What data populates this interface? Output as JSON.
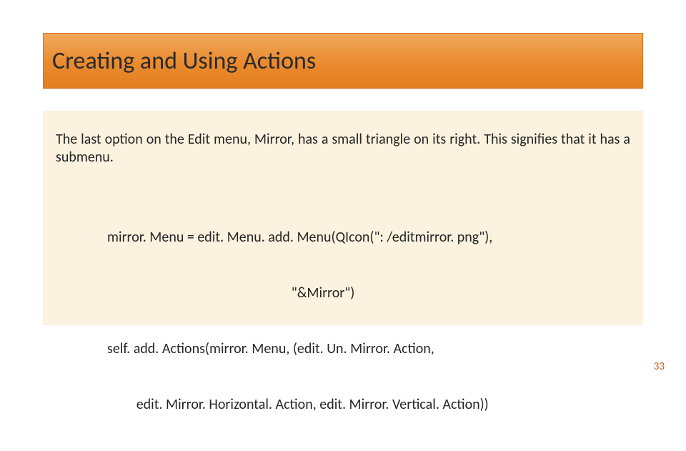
{
  "slide": {
    "title": "Creating and Using Actions",
    "intro": "The last option on the Edit menu, Mirror, has a small triangle on its right. This signifies that it has a submenu.",
    "code_lines": [
      "mirror. Menu = edit. Menu. add. Menu(QIcon(\": /editmirror. png\"),",
      "                                                         \"&Mirror\")",
      "self. add. Actions(mirror. Menu, (edit. Un. Mirror. Action,",
      "         edit. Mirror. Horizontal. Action, edit. Mirror. Vertical. Action))"
    ],
    "page_number": "33"
  }
}
